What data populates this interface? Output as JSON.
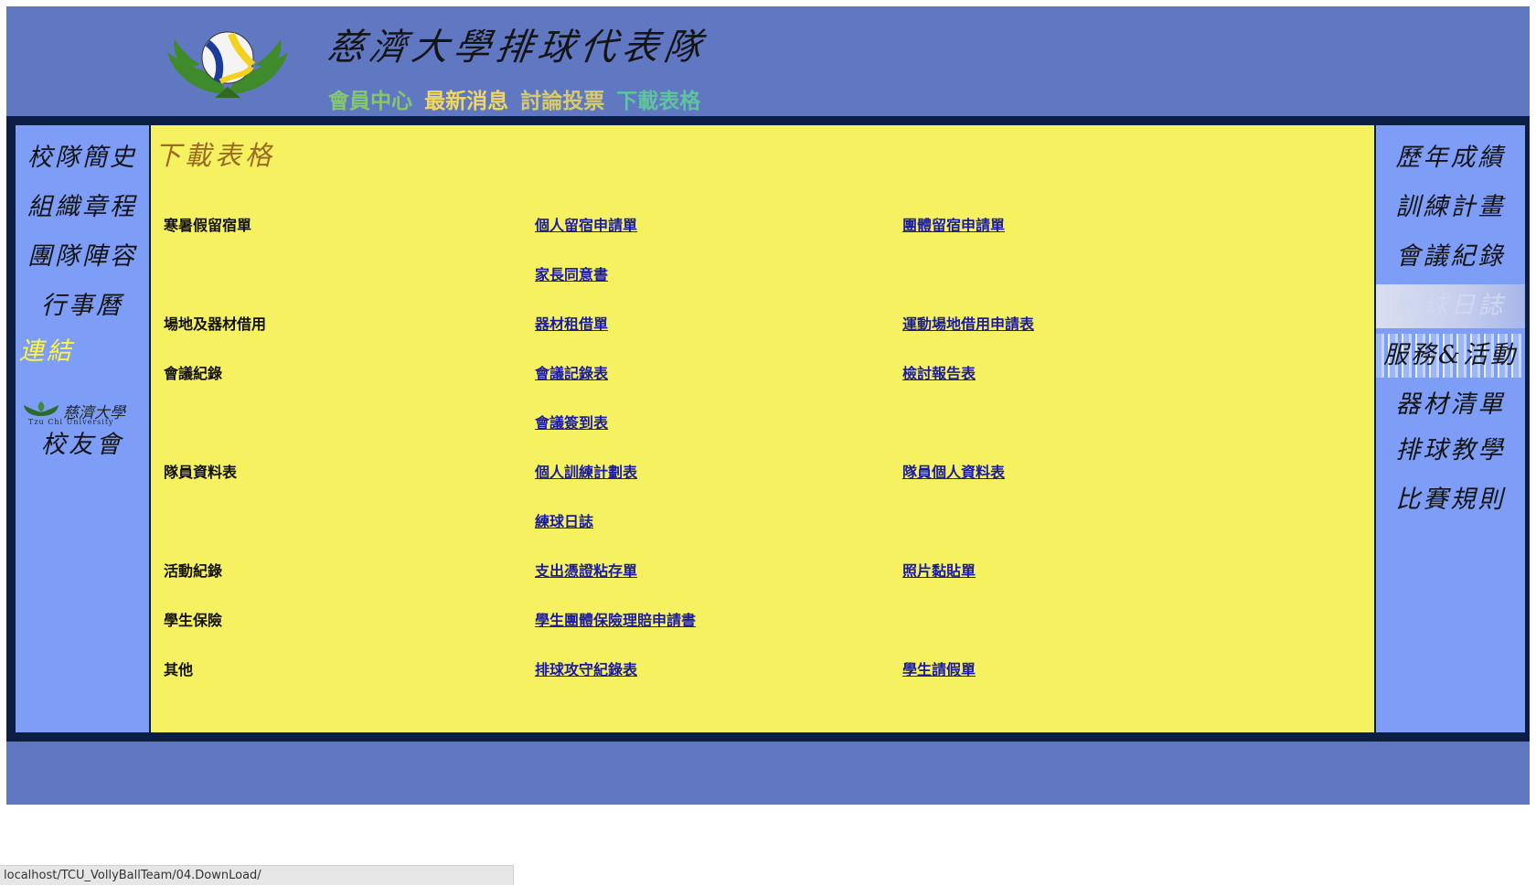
{
  "header": {
    "title": "慈濟大學排球代表隊",
    "nav": [
      {
        "label": "會員中心",
        "color": "#84c86a"
      },
      {
        "label": "最新消息",
        "color": "#f0d860"
      },
      {
        "label": "討論投票",
        "color": "#d8cb6a"
      },
      {
        "label": "下載表格",
        "color": "#5ec49e"
      }
    ]
  },
  "left_menu": [
    "校隊簡史",
    "組織章程",
    "團隊陣容",
    "行事曆",
    "連結"
  ],
  "left_extra": {
    "university_name": "慈濟大學",
    "university_name_en": "Tzu Chi University",
    "alumni": "校友會"
  },
  "right_menu": [
    "歷年成績",
    "訓練計畫",
    "會議紀錄",
    "練球日誌",
    "服務&活動",
    "器材清單",
    "排球教學",
    "比賽規則"
  ],
  "main": {
    "heading": "下載表格",
    "rows": [
      {
        "category": "寒暑假留宿單",
        "link1": "個人留宿申請單",
        "link2": "團體留宿申請單"
      },
      {
        "category": "",
        "link1": "家長同意書",
        "link2": ""
      },
      {
        "category": "場地及器材借用",
        "link1": "器材租借單",
        "link2": "運動場地借用申請表"
      },
      {
        "category": "會議紀錄",
        "link1": "會議記錄表",
        "link2": "檢討報告表"
      },
      {
        "category": "",
        "link1": "會議簽到表",
        "link2": ""
      },
      {
        "category": "隊員資料表",
        "link1": "個人訓練計劃表",
        "link2": "隊員個人資料表"
      },
      {
        "category": "",
        "link1": "練球日誌",
        "link2": ""
      },
      {
        "category": "活動紀錄",
        "link1": "支出憑證粘存單",
        "link2": "照片黏貼單"
      },
      {
        "category": "學生保險",
        "link1": "學生團體保險理賠申請書",
        "link2": ""
      },
      {
        "category": "其他",
        "link1": "排球攻守紀錄表",
        "link2": "學生請假單"
      }
    ]
  },
  "status_bar": "localhost/TCU_VollyBallTeam/04.DownLoad/"
}
